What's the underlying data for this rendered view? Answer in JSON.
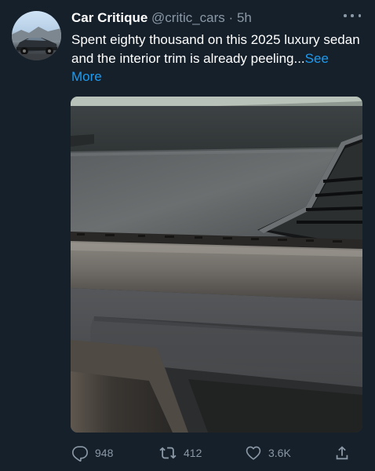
{
  "tweet": {
    "author_name": "Car Critique",
    "handle": "@critic_cars",
    "separator": "·",
    "time": "5h",
    "text": "Spent eighty thousand on this 2025 luxury sedan and the interior trim is already peeling...",
    "see_more": "See More"
  },
  "actions": {
    "replies": "948",
    "retweets": "412",
    "likes": "3.6K"
  },
  "icons": {
    "more": "more-horizontal-icon",
    "reply": "reply-icon",
    "retweet": "retweet-icon",
    "like": "heart-icon",
    "share": "share-icon"
  },
  "colors": {
    "background": "#15202b",
    "secondary_text": "#8b98a5",
    "link": "#1d9bf0"
  }
}
